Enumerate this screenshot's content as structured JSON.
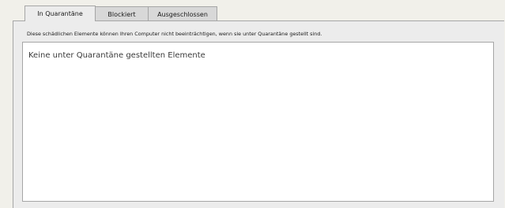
{
  "tabs": [
    {
      "label": "In Quarantäne",
      "active": true
    },
    {
      "label": "Blockiert",
      "active": false
    },
    {
      "label": "Ausgeschlossen",
      "active": false
    }
  ],
  "panel": {
    "description": "Diese schädlichen Elemente können Ihren Computer nicht beeinträchtigen, wenn sie unter Quarantäne gestellt sind.",
    "empty_message": "Keine unter Quarantäne gestellten Elemente"
  },
  "colors": {
    "background": "#f1f0ea",
    "tab_active": "#ececec",
    "tab_inactive": "#d8d8d8",
    "border": "#a6a6a6",
    "list_background": "#ffffff"
  }
}
